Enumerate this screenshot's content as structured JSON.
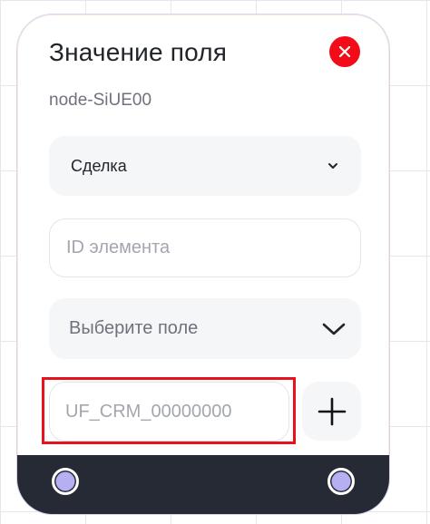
{
  "node": {
    "title": "Значение поля",
    "subtitle": "node-SiUE00",
    "entity_select": {
      "value": "Сделка"
    },
    "id_input": {
      "placeholder": "ID элемента",
      "value": ""
    },
    "field_select": {
      "placeholder": "Выберите поле"
    },
    "field_code_input": {
      "placeholder": "UF_CRM_00000000",
      "value": ""
    },
    "icons": {
      "close": "close-icon",
      "entity_chevron": "chevron-down-icon",
      "field_chevron": "chevron-down-icon",
      "add": "plus-icon"
    }
  },
  "colors": {
    "close_button": "#f20c19",
    "footer": "#262a35",
    "handle": "#b6b0f2",
    "highlight": "#e8121c"
  }
}
